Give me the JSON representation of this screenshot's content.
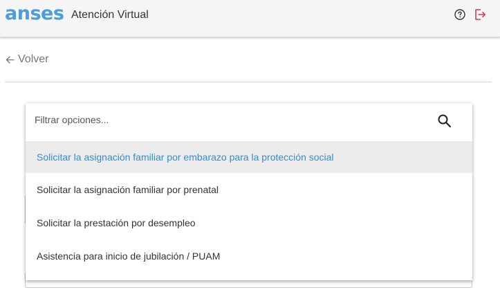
{
  "header": {
    "logo_text": "anses",
    "title": "Atención Virtual",
    "help_icon": "help-circle-icon",
    "logout_icon": "logout-icon",
    "brand_color": "#4a9fd8",
    "logout_color": "#d63a54"
  },
  "nav": {
    "back_label": "Volver"
  },
  "filter": {
    "placeholder": "Filtrar opciones..."
  },
  "options": [
    {
      "label": "Solicitar la asignación familiar por embarazo para la protección social",
      "highlighted": true
    },
    {
      "label": "Solicitar la asignación familiar por prenatal",
      "highlighted": false
    },
    {
      "label": "Solicitar la prestación por desempleo",
      "highlighted": false
    },
    {
      "label": "Asistencia para inicio de jubilación / PUAM",
      "highlighted": false
    }
  ],
  "highlight_color": "#2f8ed6"
}
